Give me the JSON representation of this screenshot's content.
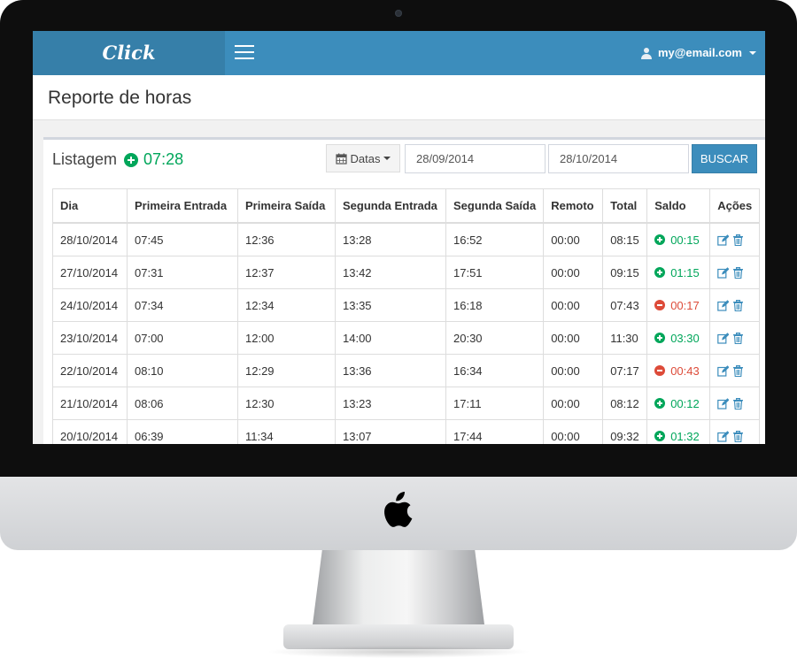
{
  "navbar": {
    "brand": "Click",
    "user_email": "my@email.com"
  },
  "page": {
    "title": "Reporte de horas"
  },
  "listing": {
    "title": "Listagem",
    "total": "07:28",
    "datas_label": "Datas",
    "date_from": "28/09/2014",
    "date_to": "28/10/2014",
    "search_label": "BUSCAR"
  },
  "table": {
    "columns": [
      "Dia",
      "Primeira Entrada",
      "Primeira Saída",
      "Segunda Entrada",
      "Segunda Saída",
      "Remoto",
      "Total",
      "Saldo",
      "Ações"
    ],
    "rows": [
      {
        "dia": "28/10/2014",
        "e1": "07:45",
        "s1": "12:36",
        "e2": "13:28",
        "s2": "16:52",
        "remoto": "00:00",
        "total": "08:15",
        "saldo": "00:15",
        "sign": "positive"
      },
      {
        "dia": "27/10/2014",
        "e1": "07:31",
        "s1": "12:37",
        "e2": "13:42",
        "s2": "17:51",
        "remoto": "00:00",
        "total": "09:15",
        "saldo": "01:15",
        "sign": "positive"
      },
      {
        "dia": "24/10/2014",
        "e1": "07:34",
        "s1": "12:34",
        "e2": "13:35",
        "s2": "16:18",
        "remoto": "00:00",
        "total": "07:43",
        "saldo": "00:17",
        "sign": "negative"
      },
      {
        "dia": "23/10/2014",
        "e1": "07:00",
        "s1": "12:00",
        "e2": "14:00",
        "s2": "20:30",
        "remoto": "00:00",
        "total": "11:30",
        "saldo": "03:30",
        "sign": "positive"
      },
      {
        "dia": "22/10/2014",
        "e1": "08:10",
        "s1": "12:29",
        "e2": "13:36",
        "s2": "16:34",
        "remoto": "00:00",
        "total": "07:17",
        "saldo": "00:43",
        "sign": "negative"
      },
      {
        "dia": "21/10/2014",
        "e1": "08:06",
        "s1": "12:30",
        "e2": "13:23",
        "s2": "17:11",
        "remoto": "00:00",
        "total": "08:12",
        "saldo": "00:12",
        "sign": "positive"
      },
      {
        "dia": "20/10/2014",
        "e1": "06:39",
        "s1": "11:34",
        "e2": "13:07",
        "s2": "17:44",
        "remoto": "00:00",
        "total": "09:32",
        "saldo": "01:32",
        "sign": "positive"
      }
    ]
  },
  "icons": {
    "menu": "hamburger-icon",
    "user": "user-icon",
    "calendar": "calendar-icon",
    "positive": "plus-circle-icon",
    "negative": "minus-circle-icon",
    "edit": "edit-icon",
    "delete": "trash-icon",
    "monitor_logo": "apple-logo-icon"
  },
  "colors": {
    "navbar": "#3c8dbc",
    "brand_bg": "#367fa9",
    "positive": "#00a65a",
    "negative": "#dd4b39"
  }
}
